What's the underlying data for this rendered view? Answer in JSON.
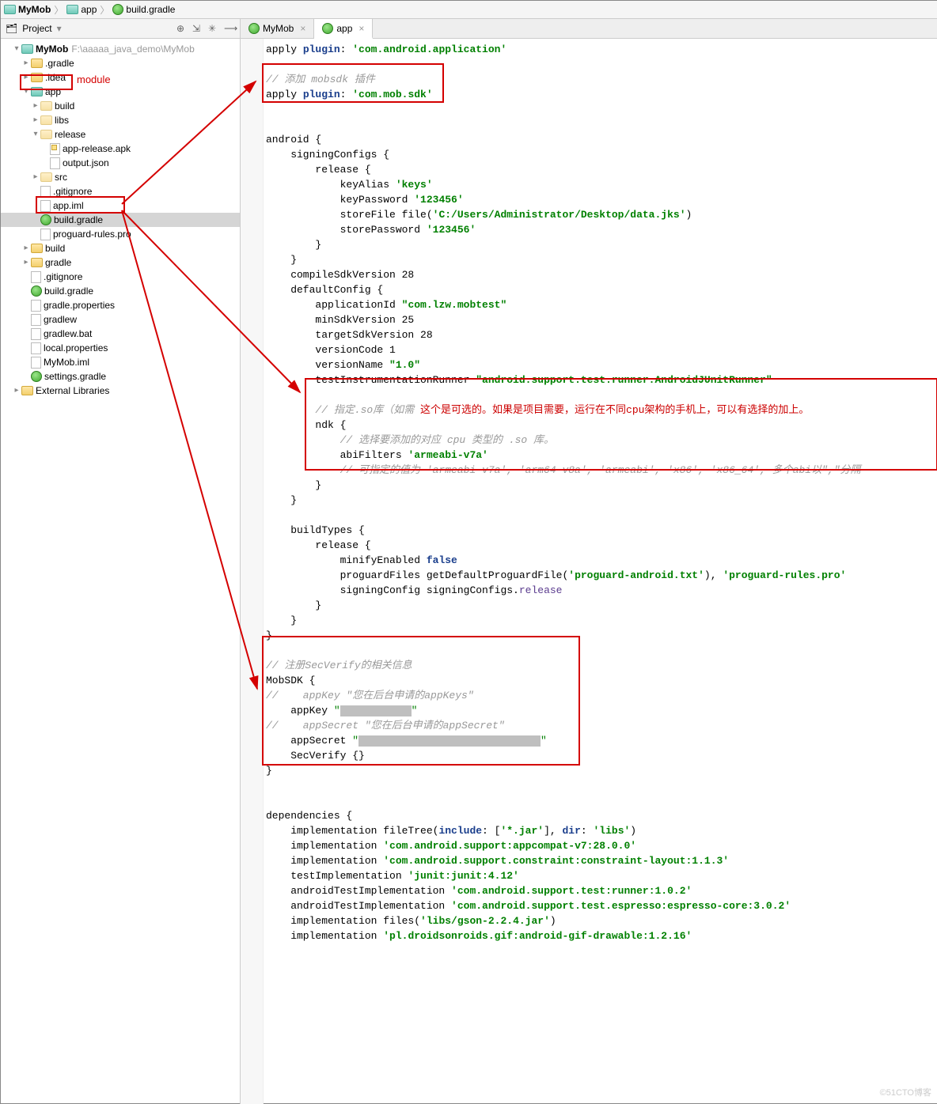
{
  "breadcrumbs": {
    "a": "MyMob",
    "b": "app",
    "c": "build.gradle"
  },
  "panel": {
    "title": "Project"
  },
  "annot": {
    "module": "module"
  },
  "tree": {
    "root": "MyMob",
    "rootPath": "F:\\aaaaa_java_demo\\MyMob",
    "gradleDir": ".gradle",
    "ideaDir": ".idea",
    "app": "app",
    "build": "build",
    "libs": "libs",
    "release": "release",
    "apk": "app-release.apk",
    "outjson": "output.json",
    "src": "src",
    "gitignore": ".gitignore",
    "appiml": "app.iml",
    "buildgradle": "build.gradle",
    "proguard": "proguard-rules.pro",
    "build2": "build",
    "gradle2": "gradle",
    "gitignore2": ".gitignore",
    "buildgradle2": "build.gradle",
    "gradleprops": "gradle.properties",
    "gradlew": "gradlew",
    "gradlewbat": "gradlew.bat",
    "localprops": "local.properties",
    "mymobiml": "MyMob.iml",
    "settings": "settings.gradle",
    "extlib": "External Libraries"
  },
  "tabs": {
    "a": "MyMob",
    "b": "app"
  },
  "code": {
    "l1a": "apply ",
    "l1b": "plugin",
    "l1c": ": ",
    "l1d": "'com.android.application'",
    "l3": "// 添加 mobsdk 插件",
    "l4a": "apply ",
    "l4b": "plugin",
    "l4c": ": ",
    "l4d": "'com.mob.sdk'",
    "l6": "android {",
    "l7": "    signingConfigs {",
    "l8": "        release {",
    "l9a": "            keyAlias ",
    "l9b": "'keys'",
    "l10a": "            keyPassword ",
    "l10b": "'123456'",
    "l11a": "            storeFile file(",
    "l11b": "'C:/Users/Administrator/Desktop/data.jks'",
    "l11c": ")",
    "l12a": "            storePassword ",
    "l12b": "'123456'",
    "l13": "        }",
    "l14": "    }",
    "l15": "    compileSdkVersion 28",
    "l16": "    defaultConfig {",
    "l17a": "        applicationId ",
    "l17b": "\"com.lzw.mobtest\"",
    "l18": "        minSdkVersion 25",
    "l19": "        targetSdkVersion 28",
    "l20": "        versionCode 1",
    "l21a": "        versionName ",
    "l21b": "\"1.0\"",
    "l22a": "        testInstrumentationRunner ",
    "l22b": "\"android.support.test.runner.AndroidJUnitRunner\"",
    "l24a": "        // 指定.so库（如需 ",
    "l24b": "这个是可选的。如果是项目需要，运行在不同cpu架构的手机上，可以有选择的加上。",
    "l25": "        ndk {",
    "l26": "            // 选择要添加的对应 cpu 类型的 .so 库。",
    "l27a": "            abiFilters ",
    "l27b": "'armeabi-v7a'",
    "l28": "            // 可指定的值为 'armeabi-v7a', 'arm64-v8a', 'armeabi', 'x86', 'x86_64', 多个abi以\",\"分隔",
    "l29": "        }",
    "l30": "    }",
    "l32": "    buildTypes {",
    "l33": "        release {",
    "l34a": "            minifyEnabled ",
    "l34b": "false",
    "l35a": "            proguardFiles getDefaultProguardFile(",
    "l35b": "'proguard-android.txt'",
    "l35c": "), ",
    "l35d": "'proguard-rules.pro'",
    "l36a": "            signingConfig signingConfigs.",
    "l36b": "release",
    "l37": "        }",
    "l38": "    }",
    "l39": "}",
    "l41": "// 注册SecVerify的相关信息",
    "l42": "MobSDK {",
    "l43": "//    appKey \"您在后台申请的appKeys\"",
    "l44a": "    appKey ",
    "l44b": "\"",
    "l44c": "\"",
    "l45": "//    appSecret \"您在后台申请的appSecret\"",
    "l46a": "    appSecret ",
    "l46b": "\"",
    "l46c": "\"",
    "l47": "    SecVerify {}",
    "l48": "}",
    "l50": "dependencies {",
    "l51a": "    implementation fileTree(",
    "l51b": "include",
    "l51c": ": [",
    "l51d": "'*.jar'",
    "l51e": "], ",
    "l51f": "dir",
    "l51g": ": ",
    "l51h": "'libs'",
    "l51i": ")",
    "l52a": "    implementation ",
    "l52b": "'com.android.support:appcompat-v7:28.0.0'",
    "l53a": "    implementation ",
    "l53b": "'com.android.support.constraint:constraint-layout:1.1.3'",
    "l54a": "    testImplementation ",
    "l54b": "'junit:junit:4.12'",
    "l55a": "    androidTestImplementation ",
    "l55b": "'com.android.support.test:runner:1.0.2'",
    "l56a": "    androidTestImplementation ",
    "l56b": "'com.android.support.test.espresso:espresso-core:3.0.2'",
    "l57a": "    implementation files(",
    "l57b": "'libs/gson-2.2.4.jar'",
    "l57c": ")",
    "l58a": "    implementation ",
    "l58b": "'pl.droidsonroids.gif:android-gif-drawable:1.2.16'"
  },
  "watermark": "©51CTO博客"
}
